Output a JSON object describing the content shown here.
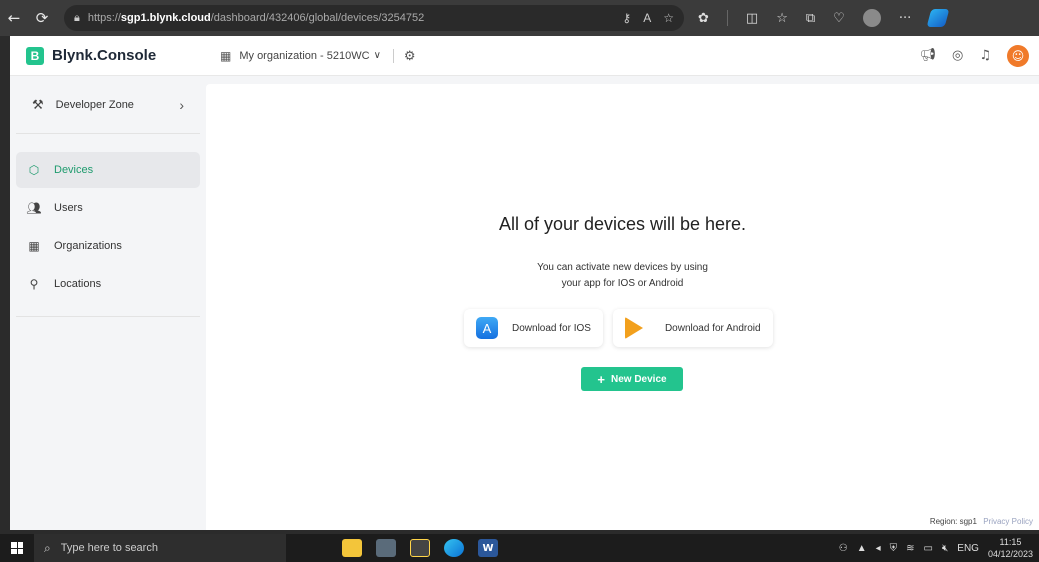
{
  "browser": {
    "url_prefix": "https://",
    "url_host": "sgp1.blynk.cloud",
    "url_path": "/dashboard/432406/global/devices/3254752"
  },
  "header": {
    "brand_letter": "B",
    "brand_name": "Blynk.Console",
    "org_label": "My organization - 5210WC"
  },
  "sidebar": {
    "developer_zone": "Developer Zone",
    "items": [
      {
        "label": "Devices",
        "icon": "cube-icon"
      },
      {
        "label": "Users",
        "icon": "users-icon"
      },
      {
        "label": "Organizations",
        "icon": "building-icon"
      },
      {
        "label": "Locations",
        "icon": "location-pin-icon"
      }
    ]
  },
  "main": {
    "empty_title": "All of your devices will be here.",
    "empty_line1": "You can activate new devices by using",
    "empty_line2": "your app for IOS or Android",
    "ios_button": "Download for IOS",
    "android_button": "Download for Android",
    "new_device_button": "New Device",
    "region_text": "Region: sgp1",
    "privacy_link": "Privacy Policy"
  },
  "taskbar": {
    "search_placeholder": "Type here to search",
    "language": "ENG",
    "time": "11:15",
    "date": "04/12/2023"
  },
  "colors": {
    "accent": "#23c48e",
    "active_text": "#1f9b6e"
  }
}
